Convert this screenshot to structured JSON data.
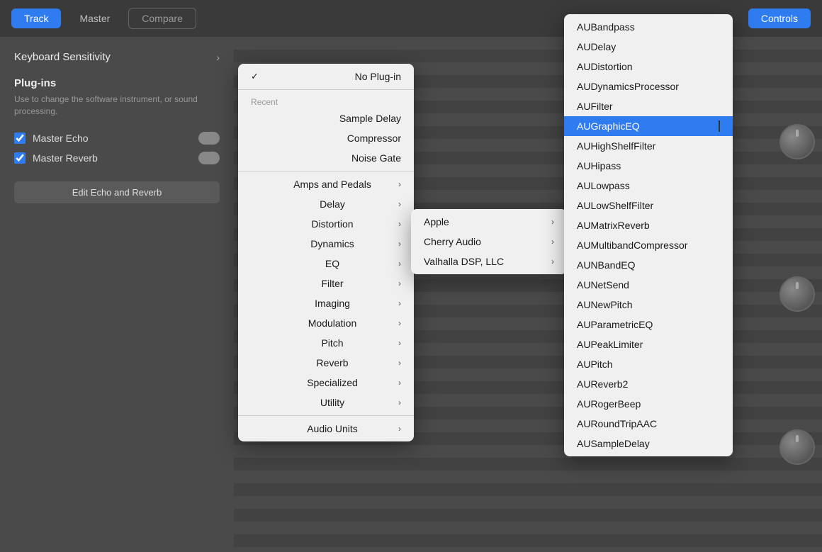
{
  "toolbar": {
    "track_label": "Track",
    "master_label": "Master",
    "compare_label": "Compare",
    "controls_label": "Controls"
  },
  "left_panel": {
    "keyboard_sensitivity_label": "Keyboard Sensitivity",
    "plugins_title": "Plug-ins",
    "plugins_desc": "Use to change the software instrument, or sound processing.",
    "master_echo_label": "Master Echo",
    "master_reverb_label": "Master Reverb",
    "edit_button_label": "Edit Echo and Reverb"
  },
  "menu_level1": {
    "no_plugin_label": "No Plug-in",
    "recent_label": "Recent",
    "recent_items": [
      {
        "label": "Sample Delay"
      },
      {
        "label": "Compressor"
      },
      {
        "label": "Noise Gate"
      }
    ],
    "category_items": [
      {
        "label": "Amps and Pedals",
        "has_arrow": true
      },
      {
        "label": "Delay",
        "has_arrow": true
      },
      {
        "label": "Distortion",
        "has_arrow": true
      },
      {
        "label": "Dynamics",
        "has_arrow": true
      },
      {
        "label": "EQ",
        "has_arrow": true
      },
      {
        "label": "Filter",
        "has_arrow": true
      },
      {
        "label": "Imaging",
        "has_arrow": true
      },
      {
        "label": "Modulation",
        "has_arrow": true
      },
      {
        "label": "Pitch",
        "has_arrow": true
      },
      {
        "label": "Reverb",
        "has_arrow": true
      },
      {
        "label": "Specialized",
        "has_arrow": true
      },
      {
        "label": "Utility",
        "has_arrow": true
      }
    ],
    "audio_units_label": "Audio Units",
    "audio_units_has_arrow": true
  },
  "menu_level2": {
    "items": [
      {
        "label": "Apple",
        "has_arrow": true
      },
      {
        "label": "Cherry Audio",
        "has_arrow": true
      },
      {
        "label": "Valhalla DSP, LLC",
        "has_arrow": true
      }
    ]
  },
  "menu_level3": {
    "items": [
      {
        "label": "AUBandpass",
        "selected": false
      },
      {
        "label": "AUDelay",
        "selected": false
      },
      {
        "label": "AUDistortion",
        "selected": false
      },
      {
        "label": "AUDynamicsProcessor",
        "selected": false
      },
      {
        "label": "AUFilter",
        "selected": false
      },
      {
        "label": "AUGraphicEQ",
        "selected": true
      },
      {
        "label": "AUHighShelfFilter",
        "selected": false
      },
      {
        "label": "AUHipass",
        "selected": false
      },
      {
        "label": "AULowpass",
        "selected": false
      },
      {
        "label": "AULowShelfFilter",
        "selected": false
      },
      {
        "label": "AUMatrixReverb",
        "selected": false
      },
      {
        "label": "AUMultibandCompressor",
        "selected": false
      },
      {
        "label": "AUNBandEQ",
        "selected": false
      },
      {
        "label": "AUNetSend",
        "selected": false
      },
      {
        "label": "AUNewPitch",
        "selected": false
      },
      {
        "label": "AUParametricEQ",
        "selected": false
      },
      {
        "label": "AUPeakLimiter",
        "selected": false
      },
      {
        "label": "AUPitch",
        "selected": false
      },
      {
        "label": "AUReverb2",
        "selected": false
      },
      {
        "label": "AURogerBeep",
        "selected": false
      },
      {
        "label": "AURoundTripAAC",
        "selected": false
      },
      {
        "label": "AUSampleDelay",
        "selected": false
      }
    ]
  }
}
